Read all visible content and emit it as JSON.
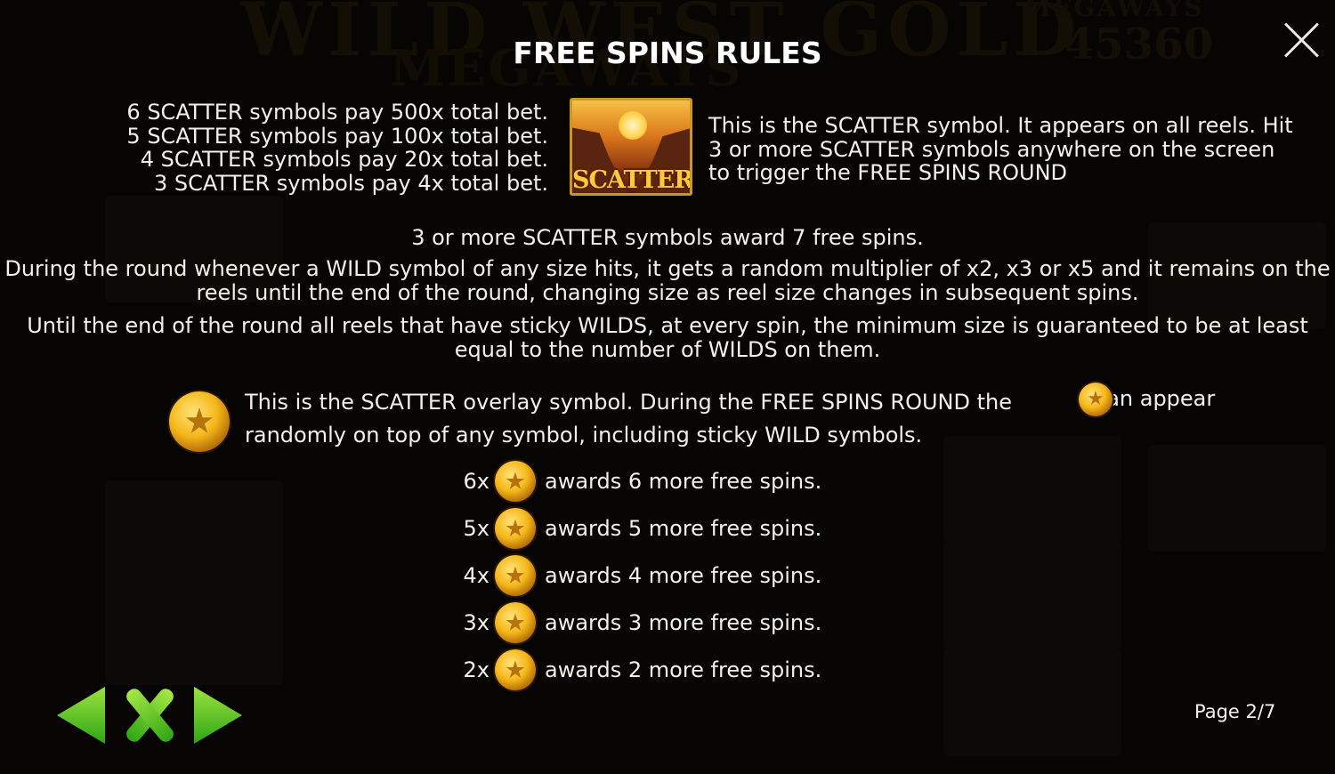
{
  "background": {
    "game_title": "WILD WEST GOLD",
    "game_subtitle": "MEGAWAYS",
    "megaways_label": "MEGAWAYS",
    "ways_count": "45360"
  },
  "title": "FREE SPINS RULES",
  "scatter_pays": [
    "6 SCATTER symbols pay 500x total bet.",
    "5 SCATTER symbols pay 100x total bet.",
    "4 SCATTER symbols pay 20x total bet.",
    "3 SCATTER symbols pay 4x total bet."
  ],
  "scatter_symbol_label": "SCATTER",
  "scatter_description": "This is the SCATTER symbol. It appears on all reels. Hit 3 or more SCATTER symbols anywhere on the screen to trigger the FREE SPINS ROUND",
  "rules": {
    "award": "3 or more SCATTER symbols award 7 free spins.",
    "wild_multiplier": "During the round whenever a WILD symbol of any size hits, it gets a random multiplier of x2, x3 or x5 and it remains on the reels until the end of the round, changing size as reel size changes in subsequent spins.",
    "sticky_wilds": "Until the end of the round all reels that have sticky WILDS, at every spin, the minimum size is guaranteed to be at least equal to the number of WILDS on them."
  },
  "overlay": {
    "icon": "sheriff-star-badge-icon",
    "description": "This is the SCATTER overlay symbol. During the FREE SPINS ROUND the randomly on top of any symbol, including sticky WILD symbols.",
    "tail": "can appear"
  },
  "awards": [
    {
      "multiplier": "6x",
      "text": "awards 6 more free spins."
    },
    {
      "multiplier": "5x",
      "text": "awards 5 more free spins."
    },
    {
      "multiplier": "4x",
      "text": "awards 4 more free spins."
    },
    {
      "multiplier": "3x",
      "text": "awards 3 more free spins."
    },
    {
      "multiplier": "2x",
      "text": "awards 2 more free spins."
    }
  ],
  "navigation": {
    "prev_icon": "arrow-left-icon",
    "close_icon": "close-x-icon",
    "next_icon": "arrow-right-icon"
  },
  "page_indicator": "Page 2/7",
  "colors": {
    "text": "#f2f0ea",
    "nav_green": "#5cc52a",
    "badge_gold": "#f5b719",
    "background": "#0a0806"
  }
}
